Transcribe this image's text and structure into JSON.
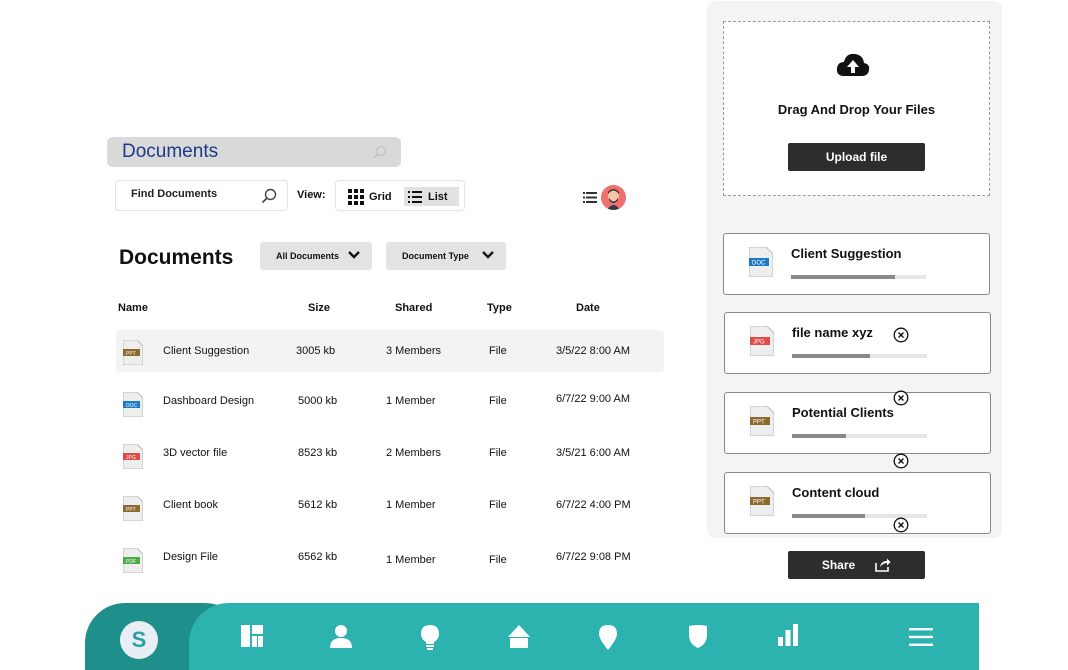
{
  "header": {
    "title": "Documents"
  },
  "toolbar": {
    "find_placeholder": "Find Documents",
    "view_label": "View:",
    "grid_label": "Grid",
    "list_label": "List"
  },
  "section": {
    "title": "Documents",
    "filter_all": "All Documents",
    "filter_type": "Document Type"
  },
  "table": {
    "columns": [
      "Name",
      "Size",
      "Shared",
      "Type",
      "Date"
    ],
    "rows": [
      {
        "icon": "ppt-file-icon",
        "name": "Client Suggestion",
        "size": "3005 kb",
        "shared": "3 Members",
        "type": "File",
        "date": "3/5/22 8:00 AM"
      },
      {
        "icon": "doc-file-icon",
        "name": "Dashboard Design",
        "size": "5000 kb",
        "shared": "1 Member",
        "type": "File",
        "date": "6/7/22 9:00 AM"
      },
      {
        "icon": "jpg-file-icon",
        "name": "3D vector file",
        "size": "8523 kb",
        "shared": "2 Members",
        "type": "File",
        "date": "3/5/21 6:00 AM"
      },
      {
        "icon": "ppt-file-icon",
        "name": "Client book",
        "size": "5612 kb",
        "shared": "1 Member",
        "type": "File",
        "date": "6/7/22 4:00 PM"
      },
      {
        "icon": "pdf-file-icon",
        "name": "Design File",
        "size": "6562 kb",
        "shared": "1 Member",
        "type": "File",
        "date": "6/7/22 9:08 PM"
      }
    ]
  },
  "upload": {
    "title": "Drag And Drop Your Files",
    "button": "Upload file",
    "files": [
      {
        "icon": "doc-file-icon",
        "name": "Client Suggestion",
        "progress": 0.77
      },
      {
        "icon": "jpg-file-icon",
        "name": "file name xyz",
        "progress": 0.58
      },
      {
        "icon": "ppt-file-icon",
        "name": "Potential Clients",
        "progress": 0.4
      },
      {
        "icon": "ppt-file-icon",
        "name": "Content cloud",
        "progress": 0.54
      }
    ],
    "share": "Share"
  },
  "nav": {
    "logo": "S",
    "items": [
      "dashboard-icon",
      "user-icon",
      "bulb-icon",
      "home-icon",
      "location-icon",
      "shield-icon",
      "chart-icon",
      "menu-icon"
    ]
  },
  "colors": {
    "accent": "#2cb3b0",
    "accent_dark": "#1f8f8c",
    "title_blue": "#1a3a8c",
    "button_dark": "#2d2d2d"
  }
}
